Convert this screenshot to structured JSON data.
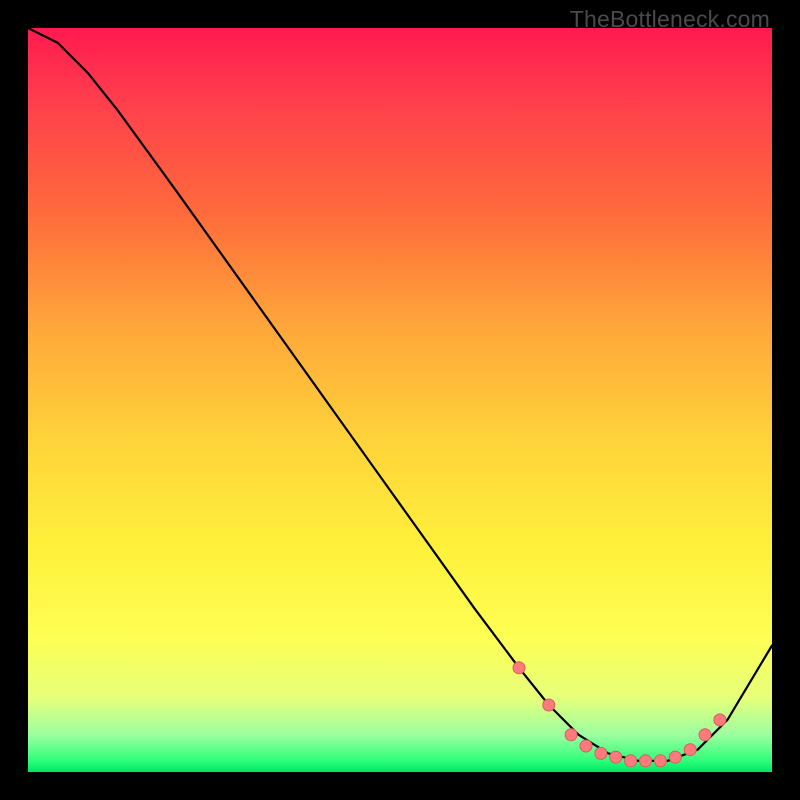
{
  "watermark": "TheBottleneck.com",
  "colors": {
    "background": "#000000",
    "curve": "#000000",
    "markers": "#ff7a7a",
    "marker_stroke": "#d85f5f"
  },
  "chart_data": {
    "type": "line",
    "title": "",
    "xlabel": "",
    "ylabel": "",
    "xlim": [
      0,
      100
    ],
    "ylim": [
      0,
      100
    ],
    "series": [
      {
        "name": "curve",
        "x": [
          0,
          4,
          8,
          12,
          20,
          30,
          40,
          50,
          60,
          66,
          70,
          74,
          78,
          82,
          86,
          90,
          94,
          100
        ],
        "y": [
          100,
          98,
          94,
          89,
          78,
          64,
          50,
          36,
          22,
          14,
          9,
          5,
          2.5,
          1.5,
          1.5,
          3,
          7,
          17
        ]
      }
    ],
    "markers": {
      "x": [
        66,
        70,
        73,
        75,
        77,
        79,
        81,
        83,
        85,
        87,
        89,
        91,
        93
      ],
      "y": [
        14,
        9,
        5,
        3.5,
        2.5,
        2,
        1.5,
        1.5,
        1.5,
        2,
        3,
        5,
        7
      ]
    }
  }
}
